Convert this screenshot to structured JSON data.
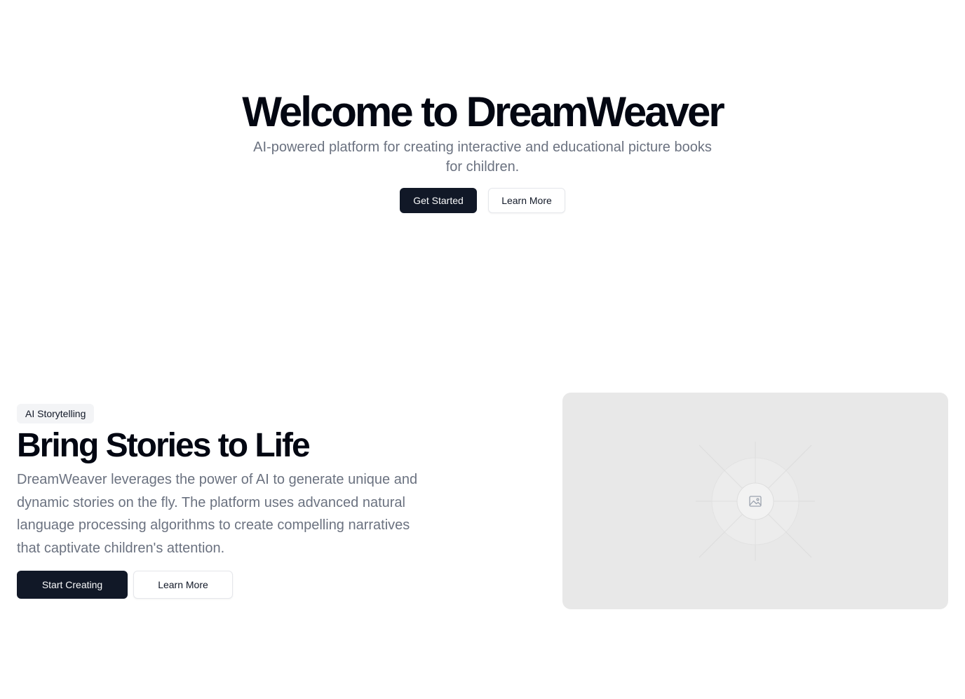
{
  "hero": {
    "title": "Welcome to DreamWeaver",
    "subtitle": "AI-powered platform for creating interactive and educational picture books for children.",
    "primary_button": "Get Started",
    "secondary_button": "Learn More"
  },
  "feature": {
    "badge": "AI Storytelling",
    "title": "Bring Stories to Life",
    "description": "DreamWeaver leverages the power of AI to generate unique and dynamic stories on the fly. The platform uses advanced natural language processing algorithms to create compelling narratives that captivate children's attention.",
    "primary_button": "Start Creating",
    "secondary_button": "Learn More",
    "image_icon": "image-icon"
  },
  "colors": {
    "primary": "#111827",
    "muted_text": "#6b7280",
    "placeholder_bg": "#e8e8e8"
  }
}
